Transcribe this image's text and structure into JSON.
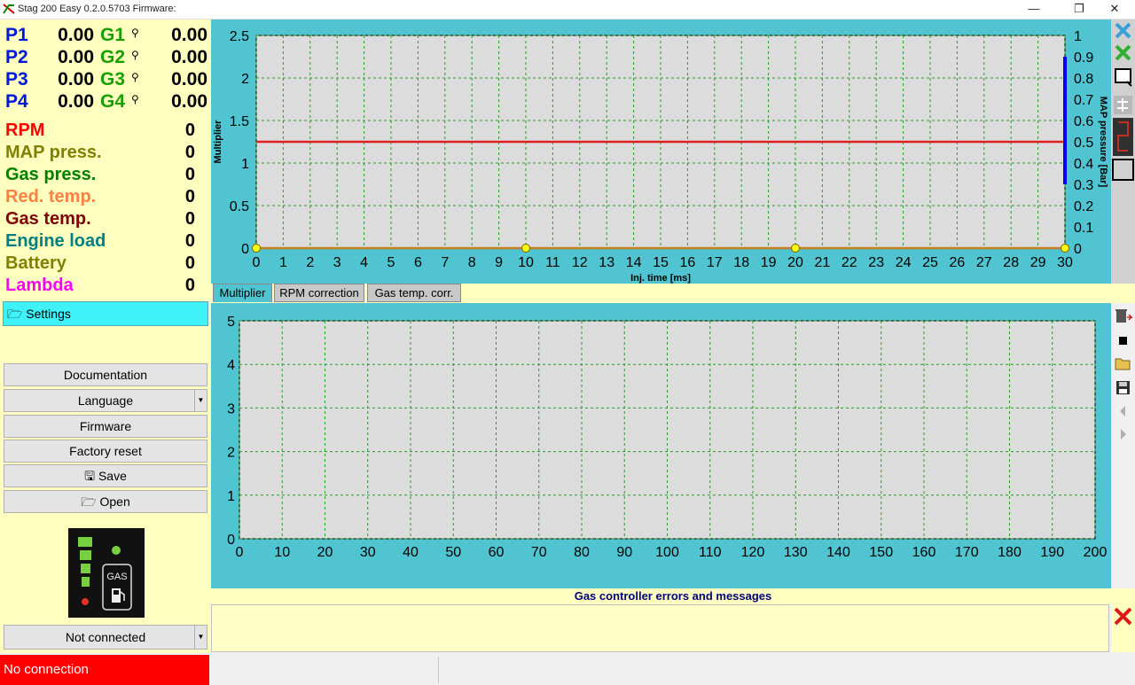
{
  "window": {
    "title": "Stag 200 Easy 0.2.0.5703 Firmware:",
    "minimize": "—",
    "maximize": "❐",
    "close": "✕"
  },
  "readouts": {
    "injectors": [
      {
        "p_label": "P1",
        "p_value": "0.00",
        "g_label": "G1",
        "g_value": "0.00"
      },
      {
        "p_label": "P2",
        "p_value": "0.00",
        "g_label": "G2",
        "g_value": "0.00"
      },
      {
        "p_label": "P3",
        "p_value": "0.00",
        "g_label": "G3",
        "g_value": "0.00"
      },
      {
        "p_label": "P4",
        "p_value": "0.00",
        "g_label": "G4",
        "g_value": "0.00"
      }
    ],
    "params": [
      {
        "label": "RPM",
        "value": "0",
        "color": "#ff0000"
      },
      {
        "label": "MAP press.",
        "value": "0",
        "color": "#808000"
      },
      {
        "label": "Gas press.",
        "value": "0",
        "color": "#008000"
      },
      {
        "label": "Red. temp.",
        "value": "0",
        "color": "#ff8040"
      },
      {
        "label": "Gas temp.",
        "value": "0",
        "color": "#800000"
      },
      {
        "label": "Engine load",
        "value": "0",
        "color": "#008080"
      },
      {
        "label": "Battery",
        "value": "0",
        "color": "#808000"
      },
      {
        "label": "Lambda",
        "value": "0",
        "color": "#ff00ff"
      }
    ]
  },
  "sidebar": {
    "settings": "Settings",
    "documentation": "Documentation",
    "language": "Language",
    "firmware": "Firmware",
    "factory_reset": "Factory reset",
    "save": "Save",
    "open": "Open",
    "connection_select": "Not connected",
    "gas_label": "GAS"
  },
  "status": {
    "connection": "No connection"
  },
  "tabs": [
    {
      "label": "Multiplier",
      "active": true
    },
    {
      "label": "RPM correction",
      "active": false
    },
    {
      "label": "Gas temp. corr.",
      "active": false
    }
  ],
  "messages": {
    "title": "Gas controller errors and messages"
  },
  "chart_data": [
    {
      "type": "line",
      "xlabel": "Inj. time [ms]",
      "ylabel": "Multiplier",
      "y2label": "MAP pressure [Bar]",
      "xlim": [
        0,
        30
      ],
      "ylim": [
        0,
        2.5
      ],
      "y2lim": [
        0,
        1
      ],
      "x_ticks": [
        0,
        1,
        2,
        3,
        4,
        5,
        6,
        7,
        8,
        9,
        10,
        11,
        12,
        13,
        14,
        15,
        16,
        17,
        18,
        19,
        20,
        21,
        22,
        23,
        24,
        25,
        26,
        27,
        28,
        29,
        30
      ],
      "y_ticks": [
        "0",
        "0.5",
        "1",
        "1.5",
        "2",
        "2.5"
      ],
      "y2_ticks": [
        "0",
        "0.1",
        "0.2",
        "0.3",
        "0.4",
        "0.5",
        "0.6",
        "0.7",
        "0.8",
        "0.9",
        "1"
      ],
      "grid": true,
      "reference_line": {
        "y": 1.25,
        "color": "#e02020"
      },
      "series": [
        {
          "x": [
            0,
            10,
            20,
            30
          ],
          "y": [
            0,
            0,
            0,
            0
          ],
          "color": "#c08020",
          "marker_color": "#ffff00"
        }
      ],
      "map_range_bar": {
        "from": 0.3,
        "to": 0.9,
        "color": "#0000ff"
      }
    },
    {
      "type": "line",
      "xlim": [
        0,
        200
      ],
      "ylim": [
        0,
        5
      ],
      "x_ticks": [
        0,
        10,
        20,
        30,
        40,
        50,
        60,
        70,
        80,
        90,
        100,
        110,
        120,
        130,
        140,
        150,
        160,
        170,
        180,
        190,
        200
      ],
      "y_ticks": [
        "0",
        "1",
        "2",
        "3",
        "4",
        "5"
      ],
      "grid": true,
      "series": []
    }
  ]
}
